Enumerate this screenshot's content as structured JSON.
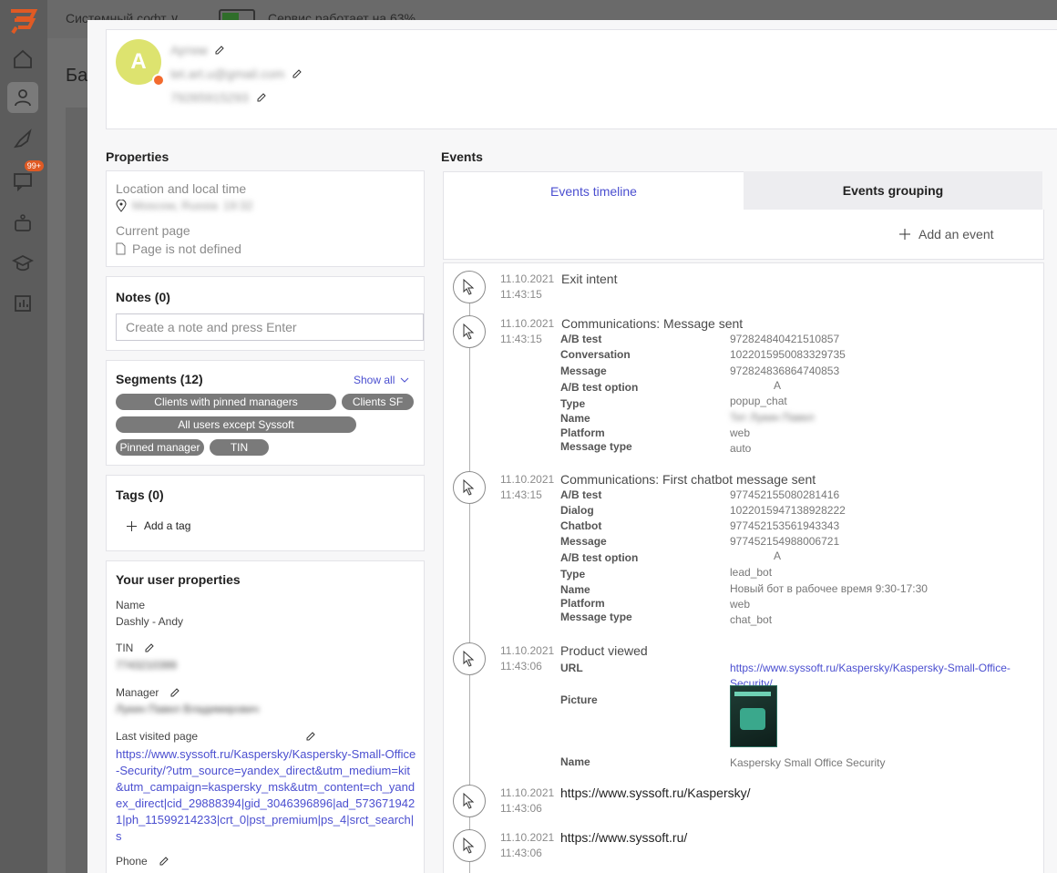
{
  "topbar": {
    "project": "Системный софт ∨",
    "status": "Сервис работает на 63%"
  },
  "background": {
    "title": "Ба"
  },
  "sidebar": {
    "chat_badge": "99+"
  },
  "user": {
    "avatar_letter": "A",
    "name": "Артем",
    "email": "tet.art.u@gmail.com",
    "phone": "79265915293"
  },
  "properties": {
    "title": "Properties",
    "location_label": "Location and local time",
    "location_value": "Moscow, Russia",
    "local_time": "19:32",
    "current_page_label": "Current page",
    "current_page_value": "Page is not defined"
  },
  "notes": {
    "title": "Notes (0)",
    "placeholder": "Create a note and press Enter"
  },
  "segments": {
    "title": "Segments (12)",
    "show_all": "Show all",
    "items": [
      "Clients with pinned managers",
      "Clients SF",
      "All users except Syssoft",
      "Pinned manager",
      "TIN"
    ]
  },
  "tags": {
    "title": "Tags (0)",
    "add": "Add a tag"
  },
  "user_properties": {
    "title": "Your user properties",
    "name_label": "Name",
    "name_value": "Dashly - Andy",
    "tin_label": "TIN",
    "tin_value": "7743210399",
    "manager_label": "Manager",
    "manager_value": "Лукин Павел Владимирович",
    "last_page_label": "Last visited page",
    "last_page_value": "https://www.syssoft.ru/Kaspersky/Kaspersky-Small-Office-Security/?utm_source=yandex_direct&utm_medium=kit&utm_campaign=kaspersky_msk&utm_content=ch_yandex_direct|cid_29888394|gid_3046396896|ad_5736719421|ph_11599214233|crt_0|pst_premium|ps_4|srct_search|s",
    "phone_label": "Phone"
  },
  "events": {
    "title": "Events",
    "tab_timeline": "Events timeline",
    "tab_grouping": "Events grouping",
    "add_event": "Add an event",
    "items": [
      {
        "date": "11.10.2021",
        "time": "11:43:15",
        "title": "Exit intent"
      },
      {
        "date": "11.10.2021",
        "time": "11:43:15",
        "title": "Communications: Message sent",
        "props": [
          {
            "k": "A/B test",
            "v": "972824840421510857"
          },
          {
            "k": "Conversation",
            "v": "1022015950083329735"
          },
          {
            "k": "Message",
            "v": "972824836864740853"
          },
          {
            "k": "A/B test option",
            "v": "A"
          },
          {
            "k": "Type",
            "v": "popup_chat"
          },
          {
            "k": "Name",
            "v": "Тет Лукин Павел"
          },
          {
            "k": "Platform",
            "v": "web"
          },
          {
            "k": "Message type",
            "v": "auto"
          }
        ]
      },
      {
        "date": "11.10.2021",
        "time": "11:43:15",
        "title": "Communications: First chatbot message sent",
        "props": [
          {
            "k": "A/B test",
            "v": "977452155080281416"
          },
          {
            "k": "Dialog",
            "v": "1022015947138928222"
          },
          {
            "k": "Chatbot",
            "v": "977452153561943343"
          },
          {
            "k": "Message",
            "v": "977452154988006721"
          },
          {
            "k": "A/B test option",
            "v": "A"
          },
          {
            "k": "Type",
            "v": "lead_bot"
          },
          {
            "k": "Name",
            "v": "Новый бот в рабочее время 9:30-17:30"
          },
          {
            "k": "Platform",
            "v": "web"
          },
          {
            "k": "Message type",
            "v": "chat_bot"
          }
        ]
      },
      {
        "date": "11.10.2021",
        "time": "11:43:06",
        "title": "Product viewed",
        "url_label": "URL",
        "url_line1": "https://www.syssoft.ru/Kaspersky/Kaspersky-Small-Office-",
        "url_line2": "Security/",
        "picture_label": "Picture",
        "name_label": "Name",
        "name_value": "Kaspersky Small Office Security"
      },
      {
        "date": "11.10.2021",
        "time": "11:43:06",
        "title": "https://www.syssoft.ru/Kaspersky/"
      },
      {
        "date": "11.10.2021",
        "time": "11:43:06",
        "title": "https://www.syssoft.ru/"
      }
    ]
  },
  "colors": {
    "accent": "#4b4fd0",
    "avatar": "#dde36f",
    "online": "#f36b2e"
  }
}
